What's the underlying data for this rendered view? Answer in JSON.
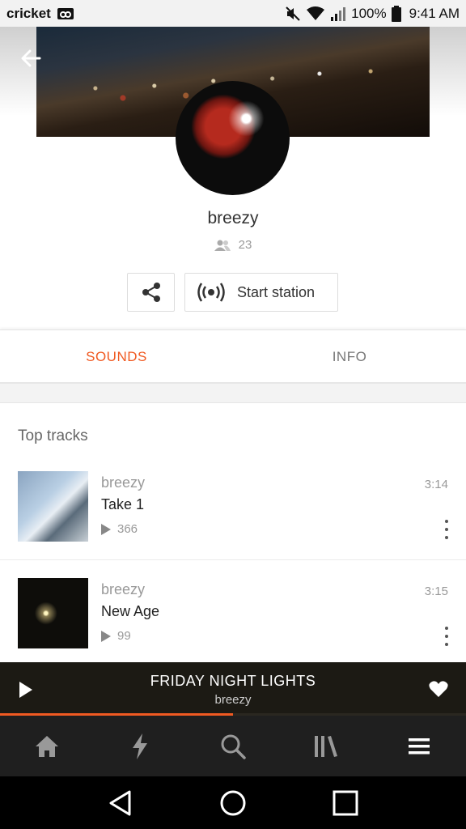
{
  "status_bar": {
    "carrier": "cricket",
    "battery": "100%",
    "time": "9:41 AM"
  },
  "profile": {
    "name": "breezy",
    "followers": "23",
    "start_station_label": "Start station"
  },
  "tabs": [
    {
      "label": "SOUNDS",
      "active": true
    },
    {
      "label": "INFO",
      "active": false
    }
  ],
  "section": {
    "title": "Top tracks"
  },
  "tracks": [
    {
      "artist": "breezy",
      "title": "Take 1",
      "plays": "366",
      "duration": "3:14"
    },
    {
      "artist": "breezy",
      "title": "New Age",
      "plays": "99",
      "duration": "3:15"
    }
  ],
  "player": {
    "title": "FRIDAY NIGHT LIGHTS",
    "artist": "breezy",
    "progress_fraction": 0.5,
    "accent_color": "#f05a22"
  },
  "bottom_nav": {
    "items": [
      "home-icon",
      "stream-icon",
      "search-icon",
      "library-icon",
      "menu-icon"
    ]
  },
  "system_nav": {
    "items": [
      "back-triangle-icon",
      "home-circle-icon",
      "recents-square-icon"
    ]
  }
}
